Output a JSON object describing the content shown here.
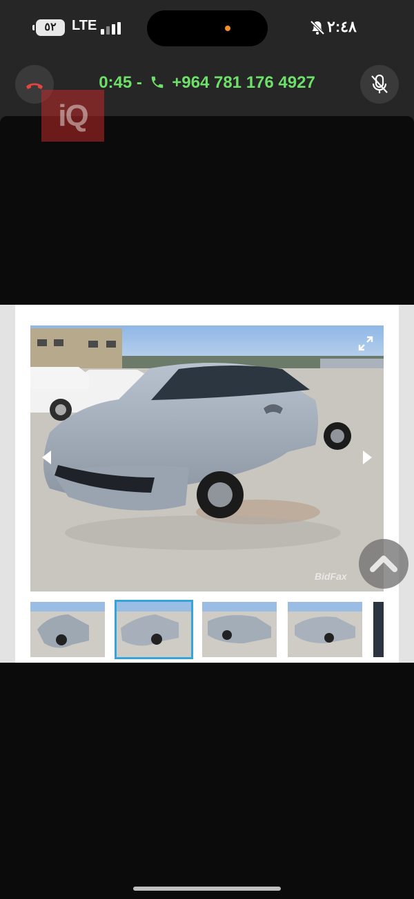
{
  "status_bar": {
    "battery_level": "٥٢",
    "network": "LTE",
    "time": "٢:٤٨",
    "icons": [
      "battery-icon",
      "signal-bars-icon",
      "silent-bell-icon"
    ],
    "orange_dot_color": "#f0902a"
  },
  "call": {
    "duration": "0:45 -",
    "number": "+964 781 176 4927",
    "text_color": "#6ee06a",
    "end_call_icon": "end-call-icon",
    "mic_icon": "mic-off-icon"
  },
  "watermark_logo": "iQ",
  "listing": {
    "photo_watermark": "BidFax",
    "thumbnail_count": 4,
    "selected_thumbnail": 2,
    "selected_color": "#36a4d6",
    "controls": [
      "expand-icon",
      "prev-arrow-icon",
      "next-arrow-icon",
      "scroll-up-icon"
    ]
  }
}
